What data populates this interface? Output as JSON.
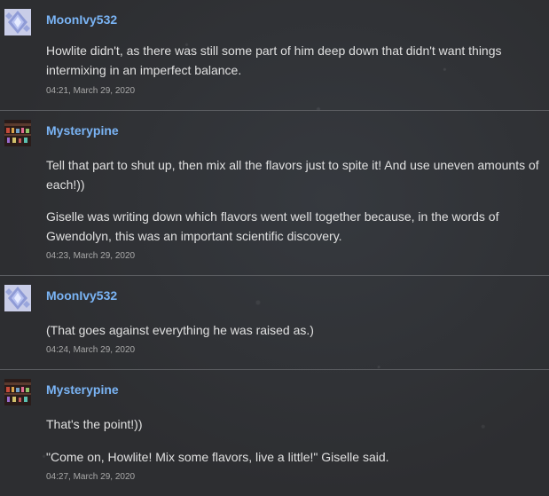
{
  "posts": [
    {
      "author": "MoonIvy532",
      "avatar_icon": "crystal-avatar-icon",
      "paragraphs": [
        "Howlite didn't, as there was still some part of him deep down that didn't want things intermixing in an imperfect balance."
      ],
      "timestamp": "04:21, March 29, 2020"
    },
    {
      "author": "Mysterypine",
      "avatar_icon": "shelf-avatar-icon",
      "paragraphs": [
        "Tell that part to shut up, then mix all the flavors just to spite it! And use uneven amounts of each!))",
        "Giselle was writing down which flavors went well together because, in the words of Gwendolyn, this was an important scientific discovery."
      ],
      "timestamp": "04:23, March 29, 2020"
    },
    {
      "author": "MoonIvy532",
      "avatar_icon": "crystal-avatar-icon",
      "paragraphs": [
        "(That goes against everything he was raised as.)"
      ],
      "timestamp": "04:24, March 29, 2020"
    },
    {
      "author": "Mysterypine",
      "avatar_icon": "shelf-avatar-icon",
      "paragraphs": [
        "That's the point!))",
        "\"Come on, Howlite! Mix some flavors, live a little!\" Giselle said."
      ],
      "timestamp": "04:27, March 29, 2020"
    }
  ],
  "colors": {
    "author_link": "#7ab4f5",
    "text": "#e0e0e0",
    "timestamp": "#a8a8a8",
    "divider": "#5a5c60",
    "background": "#2d2e31"
  }
}
